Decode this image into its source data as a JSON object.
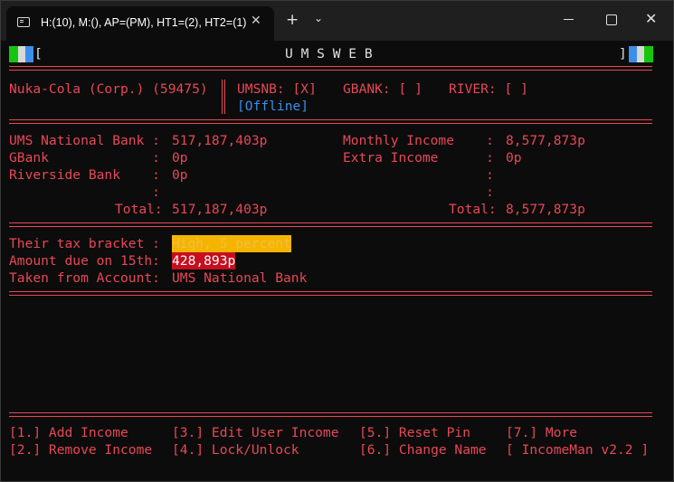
{
  "window": {
    "tab_title": "H:(10), M:(), AP=(PM), HT1=(2), HT2=(1)",
    "tab_close": "✕",
    "new_tab": "+",
    "dropdown": "⌄",
    "close": "✕"
  },
  "header": {
    "left_bracket": "[",
    "title": "U M S W E B",
    "right_bracket": "]"
  },
  "company": {
    "name": "Nuka-Cola (Corp.) (59475)"
  },
  "status": {
    "umsnb": "UMSNB: [X]",
    "gbank": "GBANK: [ ]",
    "river": "RIVER: [ ]",
    "connection": "[Offline]"
  },
  "accounts": {
    "rows": [
      {
        "label": "UMS National Bank :",
        "value": "517,187,403p"
      },
      {
        "label": "GBank             :",
        "value": "0p"
      },
      {
        "label": "Riverside Bank    :",
        "value": "0p"
      },
      {
        "label": "                  :",
        "value": ""
      }
    ],
    "total_label": "Total:",
    "total_value": "517,187,403p"
  },
  "income": {
    "rows": [
      {
        "label": "Monthly Income    :",
        "value": "8,577,873p"
      },
      {
        "label": "Extra Income      :",
        "value": "0p"
      },
      {
        "label": "                  :",
        "value": ""
      },
      {
        "label": "                  :",
        "value": ""
      }
    ],
    "total_label": "Total:",
    "total_value": "8,577,873p"
  },
  "tax": {
    "bracket_label": "Their tax bracket :",
    "bracket_value": "High, 5 percent",
    "due_label": "Amount due on 15th:",
    "due_value": "428,893p",
    "account_label": "Taken from Account:",
    "account_value": "UMS National Bank"
  },
  "menu": {
    "items": [
      "[1.] Add Income",
      "[3.] Edit User Income",
      "[5.] Reset Pin",
      "[7.] More",
      "[2.] Remove Income",
      "[4.] Lock/Unlock",
      "[6.] Change Name",
      "[ IncomeMan v2.2 ]"
    ]
  },
  "colors": {
    "primary": "#e74856",
    "accent_blue": "#3b8eea",
    "highlight_yellow": "#f5b400",
    "highlight_red": "#c50f1f",
    "background": "#0c0c0c"
  }
}
